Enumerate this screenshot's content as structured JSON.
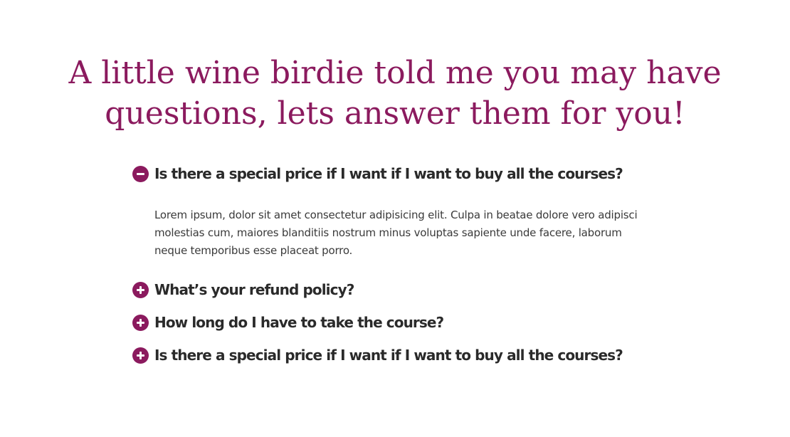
{
  "headline": "A little wine birdie told me you may have questions, lets answer them for you!",
  "faq": {
    "items": [
      {
        "question": "Is there a special price if I want if I want to buy all the courses?",
        "answer": "Lorem ipsum, dolor sit amet consectetur adipisicing elit. Culpa in beatae dolore vero adipisci molestias cum, maiores blanditiis nostrum minus voluptas sapiente unde facere, laborum neque temporibus esse placeat porro.",
        "expanded": true,
        "icon": "minus-circle-icon"
      },
      {
        "question": "What’s your refund policy?",
        "expanded": false,
        "icon": "plus-circle-icon"
      },
      {
        "question": "How long do I have to take the course?",
        "expanded": false,
        "icon": "plus-circle-icon"
      },
      {
        "question": "Is there a special price if I want if I want to buy all the courses?",
        "expanded": false,
        "icon": "plus-circle-icon"
      }
    ]
  },
  "colors": {
    "accent": "#8b1a5e",
    "question_text": "#2a2a2a",
    "body_text": "#3a3a3a"
  }
}
